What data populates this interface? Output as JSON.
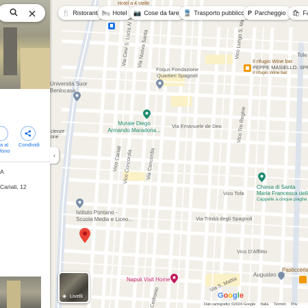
{
  "chips": [
    {
      "icon": "fork-knife-icon",
      "glyph": "🍴",
      "label": "Ristoranti"
    },
    {
      "icon": "bed-icon",
      "glyph": "🛏",
      "label": "Hotel"
    },
    {
      "icon": "camera-icon",
      "glyph": "📷",
      "label": "Cose da fare"
    },
    {
      "icon": "train-icon",
      "glyph": "🚆",
      "label": "Trasporto pubblico"
    },
    {
      "icon": "parking-icon",
      "glyph": "P",
      "label": "Parcheggio"
    },
    {
      "icon": "bag-icon",
      "glyph": "🛍",
      "label": "Fa"
    }
  ],
  "panel": {
    "search_icon": "search-icon",
    "close_icon": "close-icon",
    "share_label": "Condividi",
    "partial_labels": {
      "phone": "a al",
      "phone2": "fono",
      "left_a": "A",
      "address": "Cariati, 12"
    }
  },
  "map": {
    "places": [
      {
        "name": "Foqus Fondazione",
        "line2": "Quartieri Spagnoli",
        "type": "gray"
      },
      {
        "name": "Murale Diego",
        "line2": "Armando Maradona...",
        "type": "green"
      },
      {
        "name": "Istituto Pontano -",
        "line2": "Scuola Media e Liceo...",
        "type": "gray"
      },
      {
        "name": "Chiesa di Santa",
        "line2": "Maria Francesca delle",
        "line3": "Cappelle a cinque piaghe",
        "type": "green"
      },
      {
        "name": "Napoli Visit Home",
        "type": "pink"
      },
      {
        "name": "Il rifugio Wine bar",
        "line2": "PEPPE MASIELLO. SPRI",
        "line3": "Il rifugio Wine bar",
        "type": "orange"
      },
      {
        "name": "Università Suor",
        "line2": "Benincasa",
        "type": "gray"
      },
      {
        "name": "Pasticceria",
        "type": "orange"
      },
      {
        "name": "Augusteo",
        "type": "gray"
      },
      {
        "name": "Tole",
        "type": "gray"
      }
    ],
    "streets": [
      "Via Cesi S. Lucia Al M",
      "Via Nuova Santa",
      "Via Emanuele de Deo",
      "Vico Lungo S. Ma",
      "Vico Tre Regine",
      "Vico Tofa",
      "Via Trinità degli Spagnoli",
      "Vico D'Afflitto",
      "Via Concordia",
      "Vico Concordia",
      "Vico Cariati",
      "Via S. Mattia",
      "Vico Speranzella",
      "Cedronio",
      "Via Toledo"
    ],
    "hotel_text": "Hotel a 4 stelle",
    "other_labels": {
      "cienze": "cienze",
      "one": "one"
    }
  },
  "layers_label": "Livelli",
  "attribution": [
    "Dati cartografici ©2024 Google",
    "Italia",
    "Termini",
    "Priv"
  ],
  "brand": "Google",
  "colors": {
    "road": "#ffffff",
    "block": "#f3f0e8",
    "major": "#dde3ec",
    "pin": "#ea4335",
    "green": "#1e8a6e",
    "pink": "#c2185b"
  }
}
